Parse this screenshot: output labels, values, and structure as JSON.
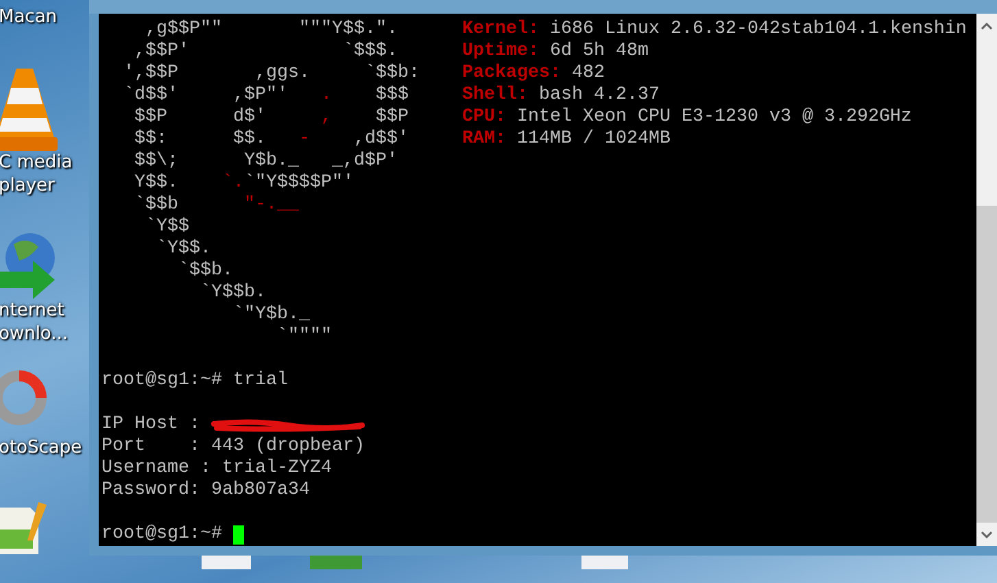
{
  "desktop_icons": [
    {
      "kind": "text-only",
      "lines": [
        "Macan"
      ]
    },
    {
      "kind": "cone",
      "lines": [
        "C media",
        "player"
      ]
    },
    {
      "kind": "globe",
      "lines": [
        "nternet",
        "ownlo..."
      ]
    },
    {
      "kind": "ring",
      "lines": [
        "otoScape"
      ]
    },
    {
      "kind": "notepad"
    }
  ],
  "terminal": {
    "ascii_logo": [
      [
        {
          "text": "    ,g$$P\"\"       \"\"\"Y$$.\".",
          "red": false
        }
      ],
      [
        {
          "text": "   ,$$P'              `$$$.",
          "red": false
        }
      ],
      [
        {
          "text": "  ',$$P       ,ggs.     `$$b:",
          "red": false
        }
      ],
      [
        {
          "text": "  `d$$'     ,$P\"'   ",
          "red": false
        },
        {
          "text": ".",
          "red": true
        },
        {
          "text": "    $$$",
          "red": false
        }
      ],
      [
        {
          "text": "   $$P      d$'     ",
          "red": false
        },
        {
          "text": ",",
          "red": true
        },
        {
          "text": "    $$P",
          "red": false
        }
      ],
      [
        {
          "text": "   $$:      $$.   ",
          "red": false
        },
        {
          "text": "-",
          "red": true
        },
        {
          "text": "    ,d$$'",
          "red": false
        }
      ],
      [
        {
          "text": "   $$\\;      Y$b._   _,d$P'",
          "red": false
        }
      ],
      [
        {
          "text": "   Y$$.    ",
          "red": false
        },
        {
          "text": "`.",
          "red": true
        },
        {
          "text": "`\"Y$$$$P\"'",
          "red": false
        }
      ],
      [
        {
          "text": "   `$$b      ",
          "red": false
        },
        {
          "text": "\"-.__",
          "red": true
        }
      ],
      [
        {
          "text": "    `Y$$",
          "red": false
        }
      ],
      [
        {
          "text": "     `Y$$.",
          "red": false
        }
      ],
      [
        {
          "text": "       `$$b.",
          "red": false
        }
      ],
      [
        {
          "text": "         `Y$$b.",
          "red": false
        }
      ],
      [
        {
          "text": "            `\"Y$b._",
          "red": false
        }
      ],
      [
        {
          "text": "                `\"\"\"\"",
          "red": false
        }
      ]
    ],
    "system_info": [
      {
        "label": "Kernel:",
        "value": "i686 Linux 2.6.32-042stab104.1.kenshin"
      },
      {
        "label": "Uptime:",
        "value": "6d 5h 48m"
      },
      {
        "label": "Packages:",
        "value": "482"
      },
      {
        "label": "Shell:",
        "value": "bash 4.2.37"
      },
      {
        "label": "CPU:",
        "value": "Intel Xeon CPU E3-1230 v3 @ 3.292GHz"
      },
      {
        "label": "RAM:",
        "value": "114MB / 1024MB"
      }
    ],
    "output": [
      {
        "kind": "blank"
      },
      {
        "kind": "command",
        "text": "root@sg1:~# trial"
      },
      {
        "kind": "blank"
      },
      {
        "kind": "redacted",
        "text": "IP Host : "
      },
      {
        "kind": "text",
        "text": "Port    : 443 (dropbear)"
      },
      {
        "kind": "text",
        "text": "Username : trial-ZYZ4"
      },
      {
        "kind": "text",
        "text": "Password: 9ab807a34"
      },
      {
        "kind": "blank"
      },
      {
        "kind": "prompt",
        "text": "root@sg1:~# "
      }
    ]
  }
}
